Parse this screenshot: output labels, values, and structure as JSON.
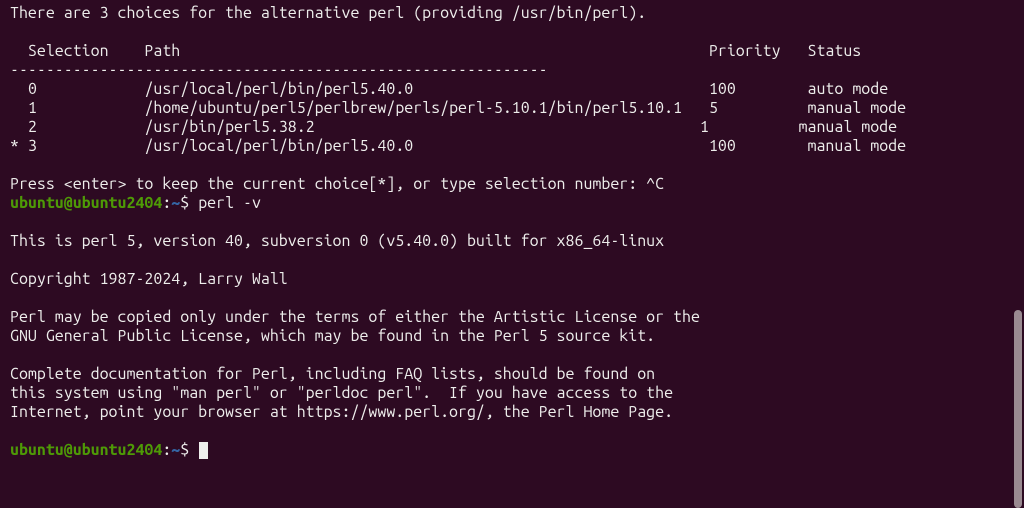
{
  "colors": {
    "background": "#2d0a22",
    "text": "#eeeeec",
    "prompt_user": "#4e9a06",
    "prompt_path": "#3465a4"
  },
  "alternatives": {
    "intro": "There are 3 choices for the alternative perl (providing /usr/bin/perl).",
    "headers": {
      "selection": "Selection",
      "path": "Path",
      "priority": "Priority",
      "status": "Status"
    },
    "separator": "------------------------------------------------------------",
    "rows": [
      {
        "marker": " ",
        "sel": "0",
        "path": "/usr/local/perl/bin/perl5.40.0",
        "priority": "100",
        "status": "auto mode"
      },
      {
        "marker": " ",
        "sel": "1",
        "path": "/home/ubuntu/perl5/perlbrew/perls/perl-5.10.1/bin/perl5.10.1",
        "priority": "5",
        "status": "manual mode"
      },
      {
        "marker": " ",
        "sel": "2",
        "path": "/usr/bin/perl5.38.2",
        "priority": "1",
        "status": "manual mode"
      },
      {
        "marker": "*",
        "sel": "3",
        "path": "/usr/local/perl/bin/perl5.40.0",
        "priority": "100",
        "status": "manual mode"
      }
    ],
    "prompt_line": "Press <enter> to keep the current choice[*], or type selection number: ^C"
  },
  "prompt1": {
    "user": "ubuntu@ubuntu2404",
    "colon": ":",
    "path": "~",
    "dollar": "$ ",
    "command": "perl -v"
  },
  "perlv": {
    "l1": "This is perl 5, version 40, subversion 0 (v5.40.0) built for x86_64-linux",
    "l2": "Copyright 1987-2024, Larry Wall",
    "l3": "Perl may be copied only under the terms of either the Artistic License or the",
    "l4": "GNU General Public License, which may be found in the Perl 5 source kit.",
    "l5": "Complete documentation for Perl, including FAQ lists, should be found on",
    "l6": "this system using \"man perl\" or \"perldoc perl\".  If you have access to the",
    "l7": "Internet, point your browser at https://www.perl.org/, the Perl Home Page."
  },
  "prompt2": {
    "user": "ubuntu@ubuntu2404",
    "colon": ":",
    "path": "~",
    "dollar": "$ ",
    "command": ""
  }
}
